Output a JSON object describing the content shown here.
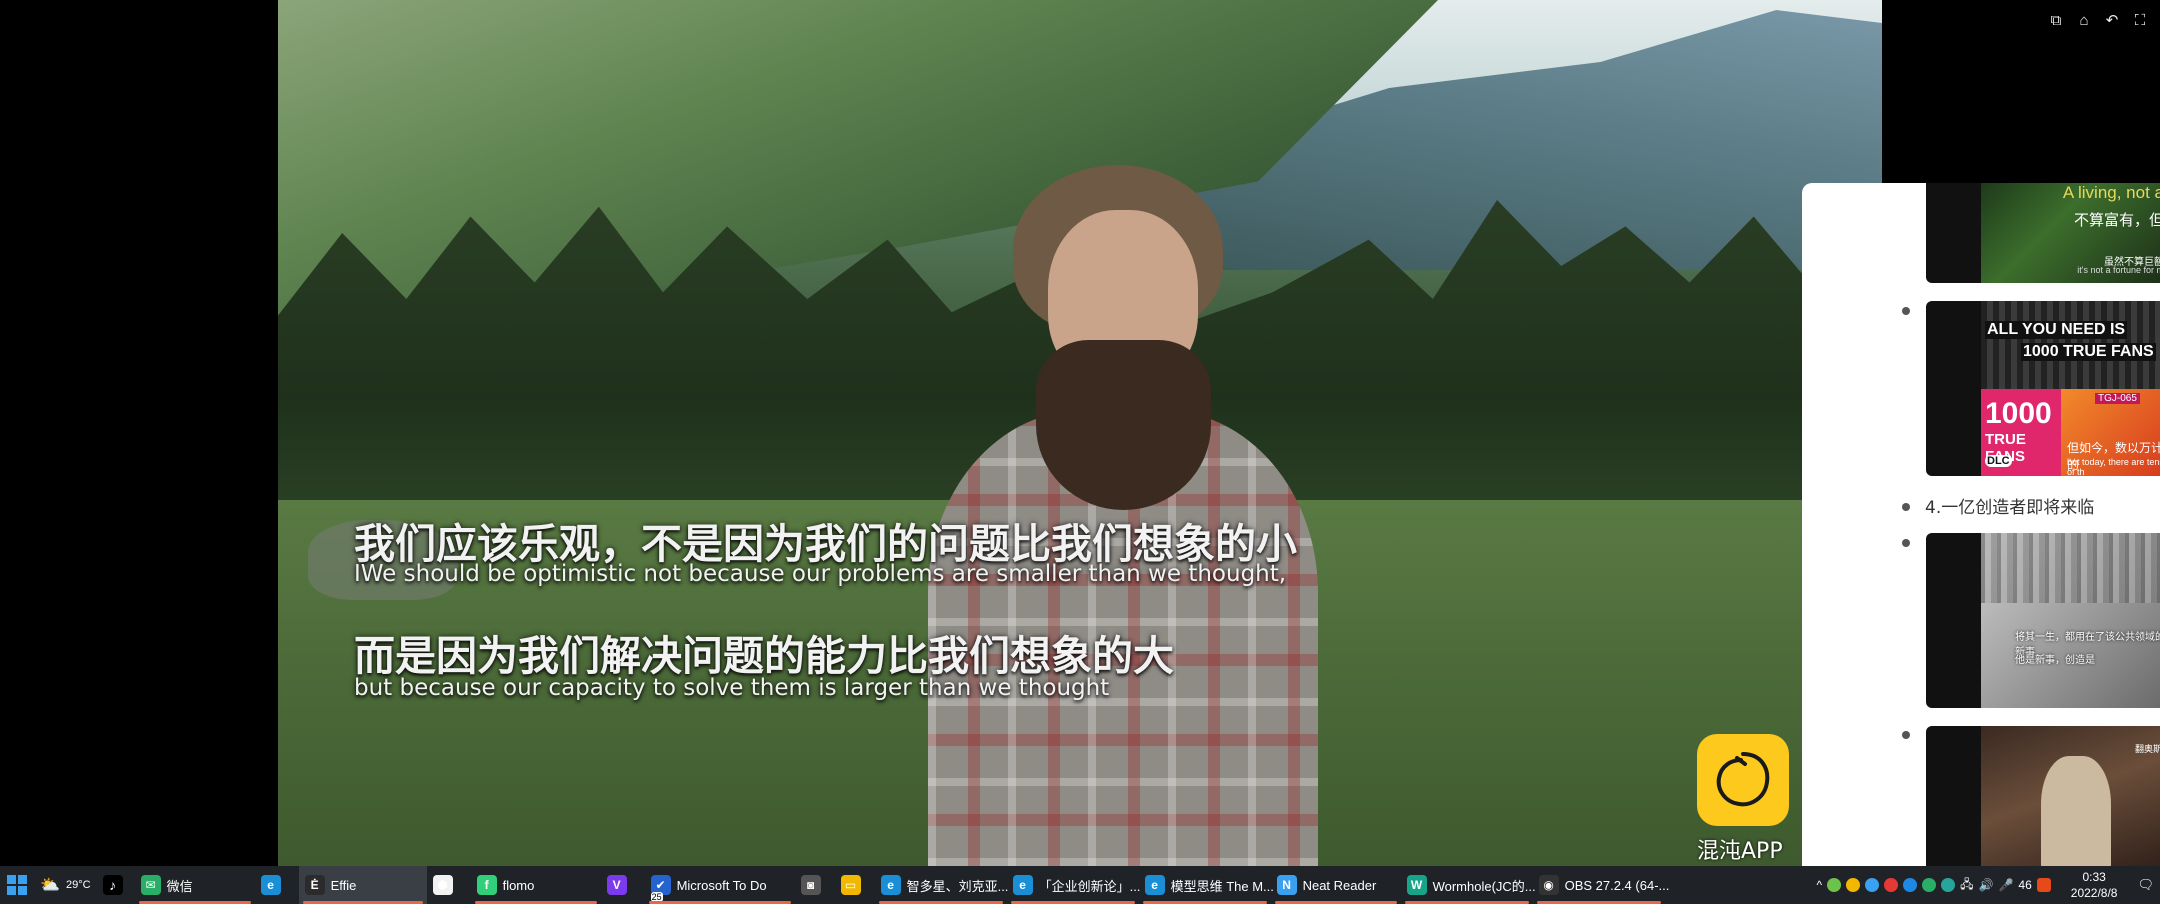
{
  "subtitles": {
    "line1_cn": "我们应该乐观，不是因为我们的问题比我们想象的小",
    "line1_en": "IWe should be optimistic not because our problems are smaller than we thought,",
    "line2_cn": "而是因为我们解决问题的能力比我们想象的大",
    "line2_en": "but because our capacity to solve them is larger than we thought"
  },
  "watermark": {
    "app_name": "混沌APP"
  },
  "panel": {
    "heading": "4.一亿创造者即将来临",
    "thumbs": {
      "t1": {
        "line_a": "A living, not a",
        "line_b": "不算富有，但",
        "line_c": "虽然不算巨额",
        "line_d": "it's not a fortune for m"
      },
      "t2": {
        "banner_a": "ALL YOU NEED IS",
        "banner_b": "1000 TRUE FANS",
        "big_num": "1000",
        "big_label": "TRUE FANS",
        "badge": "DLC",
        "code": "TGJ-065",
        "caption_cn": "但如今，数以万计的",
        "caption_en": "but today, there are tens of th"
      },
      "t3": {
        "caption_a": "将其一生，都用在了该公共领域的新事",
        "caption_b": "他是新事，创造是"
      },
      "t4": {
        "caption": "翻奥斯"
      }
    }
  },
  "taskbar": {
    "weather": "29°C",
    "items": [
      {
        "label": "微信",
        "icon": "wechat-icon",
        "color": "#2aae67",
        "glyph": "✉"
      },
      {
        "label": "",
        "icon": "edge-icon",
        "color": "#1b8fd6",
        "glyph": "e"
      },
      {
        "label": "Effie",
        "icon": "effie-icon",
        "color": "#2b2b2b",
        "glyph": "Ė"
      },
      {
        "label": "",
        "icon": "hexagon-app-icon",
        "color": "#f2f2f2",
        "glyph": "⬢"
      },
      {
        "label": "flomo",
        "icon": "flomo-icon",
        "color": "#30cf79",
        "glyph": "f"
      },
      {
        "label": "",
        "icon": "v-app-icon",
        "color": "#7c3aed",
        "glyph": "V"
      },
      {
        "label": "Microsoft To Do",
        "icon": "todo-icon",
        "color": "#2564cf",
        "glyph": "✔"
      },
      {
        "label": "",
        "icon": "screenshot-app-icon",
        "color": "#555",
        "glyph": "◙"
      },
      {
        "label": "",
        "icon": "file-explorer-icon",
        "color": "#f2b800",
        "glyph": "▭"
      },
      {
        "label": "智多星、刘克亚...",
        "icon": "edge-tab-icon",
        "color": "#1b8fd6",
        "glyph": "e"
      },
      {
        "label": "「企业创新论」...",
        "icon": "edge-tab-icon",
        "color": "#1b8fd6",
        "glyph": "e"
      },
      {
        "label": "模型思维 The M...",
        "icon": "edge-tab-icon",
        "color": "#1b8fd6",
        "glyph": "e"
      },
      {
        "label": "Neat Reader",
        "icon": "neat-reader-icon",
        "color": "#3aa0f0",
        "glyph": "N"
      },
      {
        "label": "Wormhole(JC的...",
        "icon": "wormhole-icon",
        "color": "#17a589",
        "glyph": "W"
      },
      {
        "label": "OBS 27.2.4 (64-...",
        "icon": "obs-icon",
        "color": "#333",
        "glyph": "◉"
      }
    ],
    "badge_25": "25",
    "ime": "中",
    "tray_num": "46",
    "time": "0:33",
    "date": "2022/8/8"
  },
  "colors": {
    "watermark_yellow": "#fcc91c",
    "taskbar_bg": "#1f2328",
    "active_underline": "#e5684a"
  }
}
